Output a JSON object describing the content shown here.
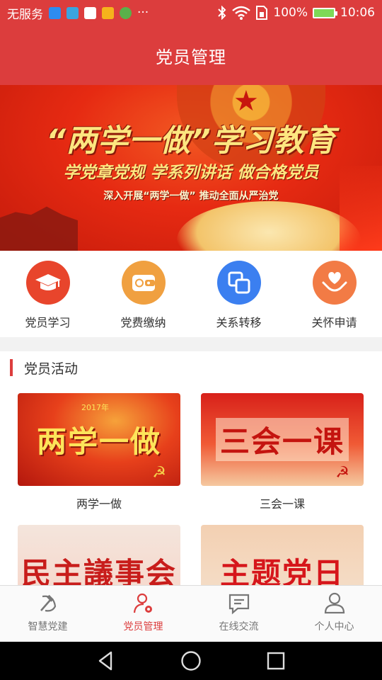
{
  "status_bar": {
    "carrier": "无服务",
    "more": "···",
    "battery_percent": "100%",
    "time": "10:06",
    "icons": [
      "bluetooth-icon",
      "wifi-icon",
      "sim-icon",
      "battery-icon"
    ]
  },
  "header": {
    "title": "党员管理"
  },
  "banner": {
    "headline": "“两学一做”学习教育",
    "subline": "学党章党规 学系列讲话 做合格党员",
    "tagline": "深入开展“两学一做” 推动全面从严治党"
  },
  "quick_menu": [
    {
      "label": "党员学习",
      "icon": "graduation-cap-icon",
      "color": "#e8452c"
    },
    {
      "label": "党费缴纳",
      "icon": "wallet-icon",
      "color": "#f0a040"
    },
    {
      "label": "关系转移",
      "icon": "transfer-icon",
      "color": "#3b7ff0"
    },
    {
      "label": "关怀申请",
      "icon": "heart-hands-icon",
      "color": "#f27b45"
    }
  ],
  "activities": {
    "title": "党员活动",
    "items": [
      {
        "label": "两学一做",
        "image_text": "两学一做",
        "image_year": "2017年"
      },
      {
        "label": "三会一课",
        "image_text": "三会一课"
      },
      {
        "label": "",
        "image_text": "民主議事会"
      },
      {
        "label": "",
        "image_text": "主题党日"
      }
    ]
  },
  "tabbar": [
    {
      "label": "智慧党建",
      "icon": "party-emblem-icon",
      "active": false
    },
    {
      "label": "党员管理",
      "icon": "user-gear-icon",
      "active": true
    },
    {
      "label": "在线交流",
      "icon": "chat-icon",
      "active": false
    },
    {
      "label": "个人中心",
      "icon": "person-icon",
      "active": false
    }
  ],
  "colors": {
    "primary": "#dc3d3d",
    "inactive": "#777777"
  }
}
